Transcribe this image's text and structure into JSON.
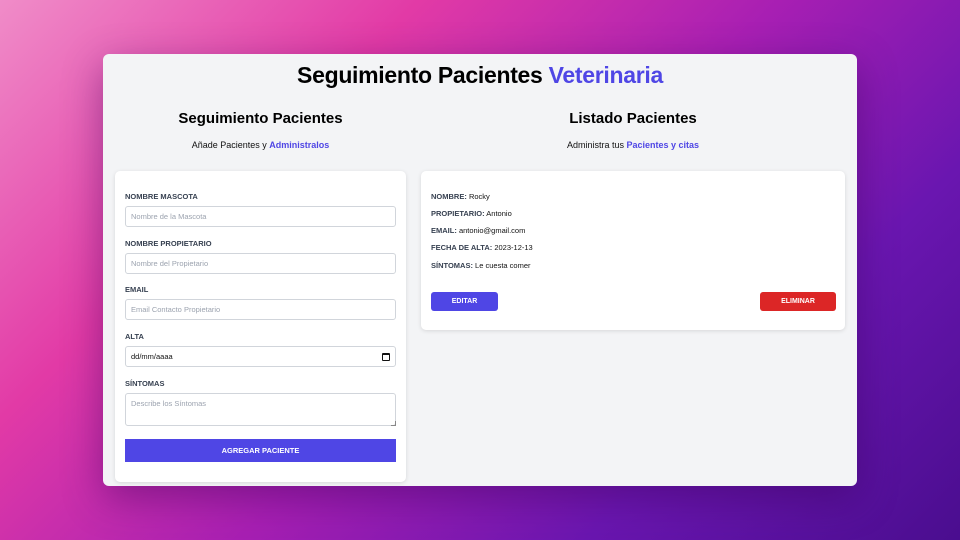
{
  "header": {
    "title_main": "Seguimiento Pacientes",
    "title_accent": "Veterinaria"
  },
  "form_section": {
    "title": "Seguimiento Pacientes",
    "subtitle_prefix": "Añade Pacientes y",
    "subtitle_accent": "Administralos"
  },
  "list_section": {
    "title": "Listado Pacientes",
    "subtitle_prefix": "Administra tus",
    "subtitle_accent": "Pacientes y citas"
  },
  "form": {
    "pet_label": "Nombre Mascota",
    "pet_placeholder": "Nombre de la Mascota",
    "owner_label": "Nombre Propietario",
    "owner_placeholder": "Nombre del Propietario",
    "email_label": "Email",
    "email_placeholder": "Email Contacto Propietario",
    "date_label": "Alta",
    "date_value": "dd/mm/aaaa",
    "symptoms_label": "Síntomas",
    "symptoms_placeholder": "Describe los Síntomas",
    "submit_label": "Agregar Paciente"
  },
  "patient": {
    "name_label": "Nombre:",
    "name": "Rocky",
    "owner_label": "Propietario:",
    "owner": "Antonio",
    "email_label": "Email:",
    "email": "antonio@gmail.com",
    "date_label": "Fecha de Alta:",
    "date": "2023-12-13",
    "symptoms_label": "Síntomas:",
    "symptoms": "Le cuesta comer",
    "edit_label": "Editar",
    "delete_label": "Eliminar"
  },
  "colors": {
    "accent": "#4f46e5",
    "danger": "#dc2626"
  }
}
